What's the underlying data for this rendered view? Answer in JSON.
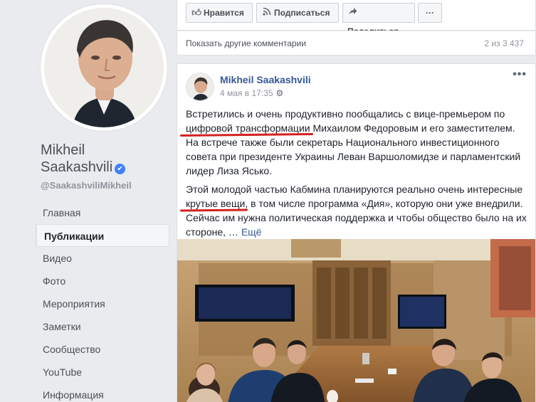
{
  "profile": {
    "name_line1": "Mikheil",
    "name_line2": "Saakashvili",
    "verified_glyph": "✔",
    "handle": "@SaakashviliMikheil"
  },
  "nav": {
    "items": [
      {
        "label": "Главная"
      },
      {
        "label": "Публикации",
        "active": true
      },
      {
        "label": "Видео"
      },
      {
        "label": "Фото"
      },
      {
        "label": "Мероприятия"
      },
      {
        "label": "Заметки"
      },
      {
        "label": "Сообщество"
      },
      {
        "label": "YouTube"
      },
      {
        "label": "Информация"
      }
    ]
  },
  "actions": {
    "like_label": "Нравится",
    "subscribe_label": "Подписаться",
    "share_label": "Поделиться",
    "more_label": "···"
  },
  "comments": {
    "show_more_label": "Показать другие комментарии",
    "count_text": "2 из 3 437"
  },
  "post": {
    "author": "Mikheil Saakashvili",
    "timestamp": "4 мая в 17:35",
    "more_label": "•••",
    "p1_a": "Встретились и очень продуктивно пообщались с вице-премьером по ",
    "p1_highlight": "цифровой трансформации",
    "p1_b": " Михаилом Федоровым и его заместителем. На встрече также были секретарь Национального инвестиционного совета при президенте Украины Леван Варшоломидзе и парламентский лидер Лиза Ясько.",
    "p2_a": "Этой молодой частью Кабмина планируются реально очень интересные ",
    "p2_highlight": "крутые вещи",
    "p2_b": ", в том числе программа «Дия», которую они уже внедрили. Сейчас им нужна политическая поддержка и чтобы общество было на их стороне, ",
    "ellipsis": "… ",
    "see_more": "Ещё"
  },
  "colors": {
    "background": "#e9ebee",
    "link": "#365899",
    "underline": "#d52020",
    "verified": "#4080ff"
  }
}
